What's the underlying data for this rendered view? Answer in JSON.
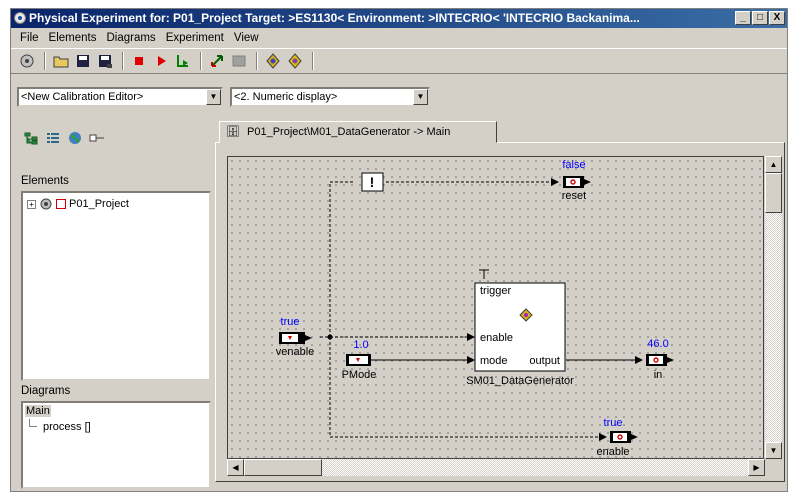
{
  "window": {
    "title": "Physical Experiment for: P01_Project  Target: >ES1130<  Environment: >INTECRIO<   'INTECRIO Backanima...",
    "controls": [
      "_",
      "□",
      "X"
    ]
  },
  "menu": [
    "File",
    "Elements",
    "Diagrams",
    "Experiment",
    "View"
  ],
  "toolbar": {
    "buttons": [
      "experiment-icon",
      "open-icon",
      "save-icon",
      "save-as-icon",
      "stop-icon",
      "run-icon",
      "step-icon",
      "connect-icon",
      "disconnect-icon",
      "calibrate-icon",
      "measure-icon"
    ]
  },
  "combos": {
    "editor": "<New Calibration Editor>",
    "display": "<2. Numeric display>"
  },
  "left_panel": {
    "elements_label": "Elements",
    "elements_tree": [
      {
        "expander": "+",
        "label": "P01_Project"
      }
    ],
    "diagrams_label": "Diagrams",
    "diagrams_tree": [
      {
        "label": "Main"
      },
      {
        "label": "process []"
      }
    ]
  },
  "editor": {
    "tab_label": "P01_Project\\M01_DataGenerator  -> Main"
  },
  "diagram": {
    "block": {
      "name": "SM01_DataGenerator",
      "ports": [
        "trigger",
        "enable",
        "mode",
        "output"
      ]
    },
    "exclamation": "!",
    "signals": [
      {
        "name": "reset",
        "value": "false"
      },
      {
        "name": "venable",
        "value": "true"
      },
      {
        "name": "PMode",
        "value": "1.0"
      },
      {
        "name": "in",
        "value": "46.0"
      },
      {
        "name": "enable",
        "value": "true"
      }
    ]
  },
  "colors": {
    "value_text": "#0000ff",
    "titlebar": "#0a246a",
    "signal_marker": "#cc0000"
  }
}
